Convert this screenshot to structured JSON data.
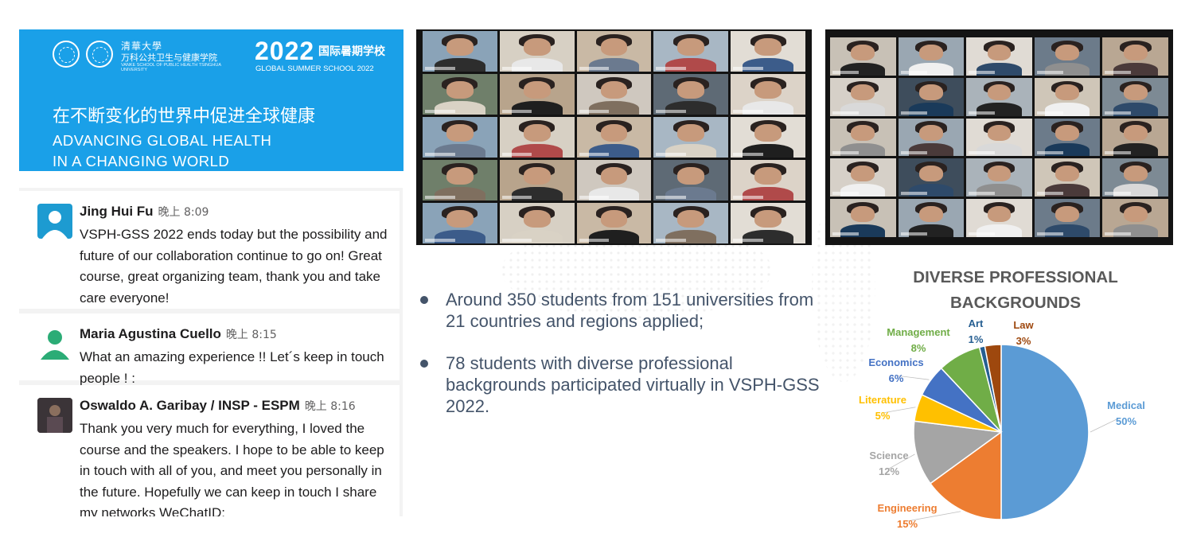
{
  "banner": {
    "brand_cn": "清華大學",
    "brand_cn_school": "万科公共卫生与健康学院",
    "brand_en": "VANKE SCHOOL OF PUBLIC HEALTH TSINGHUA UNIVERSITY",
    "year": "2022",
    "year_cn": "国际暑期学校",
    "year_en": "GLOBAL SUMMER SCHOOL 2022",
    "slogan_cn": "在不断变化的世界中促进全球健康",
    "slogan_en_line1": "ADVANCING GLOBAL HEALTH",
    "slogan_en_line2": "IN A CHANGING WORLD"
  },
  "chat": {
    "messages": [
      {
        "name": "Jing Hui Fu",
        "time": "晚上 8:09",
        "text": "VSPH-GSS 2022 ends today but the possibility and future of our collaboration continue to go on! Great course, great organizing team, thank you and take care everyone!",
        "avatar_color": "#1d9bd1"
      },
      {
        "name": "Maria Agustina Cuello",
        "time": "晚上 8:15",
        "text": "What an amazing experience !! Let´s keep in touch people ! :",
        "avatar_color": "#2bac76"
      },
      {
        "name": "Oswaldo A. Garibay / INSP - ESPM",
        "time": "晚上 8:16",
        "text": "Thank you very much for everything, I loved the course and the speakers. I hope to be able to keep in touch with all of you, and meet you personally in the future. Hopefully we can keep in touch I share my networks WeChatID:",
        "avatar_color": "#3b3438"
      }
    ]
  },
  "bullets": [
    "Around 350 students from 151 universities from 21 countries and regions applied;",
    "78 students with diverse professional backgrounds participated virtually in VSPH-GSS 2022."
  ],
  "chart_data": {
    "type": "pie",
    "title": "DIVERSE PROFESSIONAL BACKGROUNDS",
    "slices": [
      {
        "label": "Medical",
        "value": 50,
        "display": "50%",
        "color": "#5b9bd5"
      },
      {
        "label": "Engineering",
        "value": 15,
        "display": "15%",
        "color": "#ed7d31"
      },
      {
        "label": "Science",
        "value": 12,
        "display": "12%",
        "color": "#a5a5a5"
      },
      {
        "label": "Literature",
        "value": 5,
        "display": "5%",
        "color": "#ffc000"
      },
      {
        "label": "Economics",
        "value": 6,
        "display": "6%",
        "color": "#4472c4"
      },
      {
        "label": "Management",
        "value": 8,
        "display": "8%",
        "color": "#70ad47"
      },
      {
        "label": "Art",
        "value": 1,
        "display": "1%",
        "color": "#255e91"
      },
      {
        "label": "Law",
        "value": 3,
        "display": "3%",
        "color": "#9e480e"
      }
    ]
  },
  "colors": {
    "banner_bg": "#1aa0e8",
    "bullet_text": "#44546a",
    "zoom_bg": "#141414"
  }
}
